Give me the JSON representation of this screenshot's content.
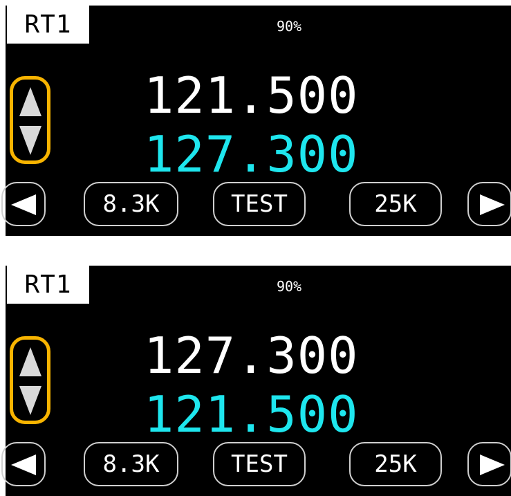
{
  "screens": [
    {
      "radio_label": "RT1",
      "volume": "90%",
      "active_frequency": "121.500",
      "standby_frequency": "127.300",
      "softkeys": {
        "left_key": "8.3K",
        "center_key": "TEST",
        "right_key": "25K"
      }
    },
    {
      "radio_label": "RT1",
      "volume": "90%",
      "active_frequency": "127.300",
      "standby_frequency": "121.500",
      "softkeys": {
        "left_key": "8.3K",
        "center_key": "TEST",
        "right_key": "25K"
      }
    }
  ],
  "colors": {
    "background": "#000000",
    "active_frequency": "#ffffff",
    "standby_frequency": "#1ee6ee",
    "swap_outline": "#f8b400",
    "button_outline": "#cfcfcf"
  },
  "icons": {
    "swap_up": "triangle-up-icon",
    "swap_down": "triangle-down-icon",
    "prev": "triangle-left-icon",
    "next": "triangle-right-icon"
  }
}
